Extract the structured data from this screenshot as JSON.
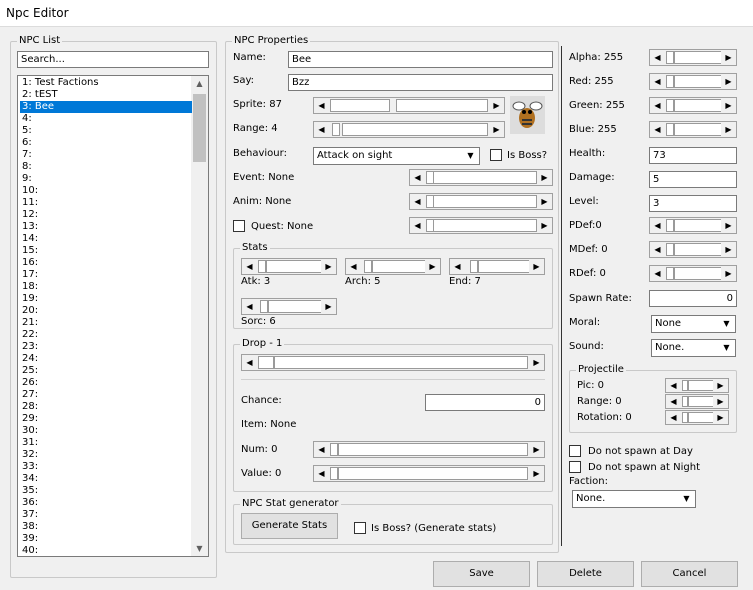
{
  "window": {
    "title": "Npc Editor"
  },
  "npc_list": {
    "label": "NPC List",
    "search": "Search...",
    "items": [
      "1: Test Factions",
      "2: tEST",
      "3: Bee",
      "4:",
      "5:",
      "6:",
      "7:",
      "8:",
      "9:",
      "10:",
      "11:",
      "12:",
      "13:",
      "14:",
      "15:",
      "16:",
      "17:",
      "18:",
      "19:",
      "20:",
      "21:",
      "22:",
      "23:",
      "24:",
      "25:",
      "26:",
      "27:",
      "28:",
      "29:",
      "30:",
      "31:",
      "32:",
      "33:",
      "34:",
      "35:",
      "36:",
      "37:",
      "38:",
      "39:",
      "40:"
    ],
    "selected_index": 2
  },
  "props": {
    "label": "NPC Properties",
    "name_label": "Name:",
    "name_value": "Bee",
    "say_label": "Say:",
    "say_value": "Bzz",
    "sprite_label": "Sprite: 87",
    "range_label": "Range: 4",
    "behaviour_label": "Behaviour:",
    "behaviour_value": "Attack on sight",
    "isboss_label": "Is Boss?",
    "event_label": "Event: None",
    "anim_label": "Anim: None",
    "quest_label": "Quest: None"
  },
  "stats": {
    "label": "Stats",
    "atk": "Atk: 3",
    "arch": "Arch: 5",
    "end": "End: 7",
    "sorc": "Sorc: 6"
  },
  "drop": {
    "label": "Drop - 1",
    "chance_label": "Chance:",
    "chance_value": "0",
    "item_label": "Item: None",
    "num_label": "Num: 0",
    "value_label": "Value: 0"
  },
  "gen": {
    "label": "NPC Stat generator",
    "button": "Generate Stats",
    "isboss_label": "Is Boss? (Generate stats)"
  },
  "right": {
    "alpha": "Alpha: 255",
    "red": "Red: 255",
    "green": "Green: 255",
    "blue": "Blue: 255",
    "health_label": "Health:",
    "health_value": "73",
    "damage_label": "Damage:",
    "damage_value": "5",
    "level_label": "Level:",
    "level_value": "3",
    "pdef": "PDef:0",
    "mdef": "MDef: 0",
    "rdef": "RDef: 0",
    "spawnrate_label": "Spawn Rate:",
    "spawnrate_value": "0",
    "moral_label": "Moral:",
    "moral_value": "None",
    "sound_label": "Sound:",
    "sound_value": "None.",
    "proj_label": "Projectile",
    "pic": "Pic: 0",
    "prange": "Range: 0",
    "rotation": "Rotation: 0",
    "noday": "Do not spawn at Day",
    "nonight": "Do not spawn at Night",
    "faction_label": "Faction:",
    "faction_value": "None."
  },
  "buttons": {
    "save": "Save",
    "delete": "Delete",
    "cancel": "Cancel"
  },
  "colors": {
    "selection": "#0078d7",
    "window_bg": "#f0f0f0"
  }
}
